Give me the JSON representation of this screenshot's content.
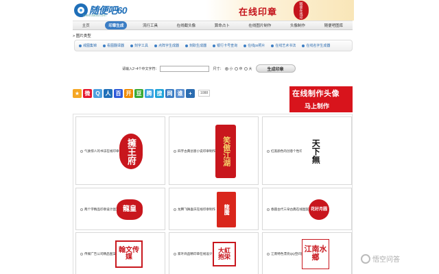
{
  "header": {
    "logo_text": "随便吧60",
    "logo_sub": "www.sbba.com",
    "banner_title": "在线印章",
    "banner_seal_text": "随便在线印"
  },
  "nav": {
    "items": [
      {
        "label": "主页",
        "active": false
      },
      {
        "label": "印章生成",
        "active": true
      },
      {
        "label": "流行工具",
        "active": false
      },
      {
        "label": "在线截头像",
        "active": false
      },
      {
        "label": "算命占卜",
        "active": false
      },
      {
        "label": "在线图片制作",
        "active": false
      },
      {
        "label": "头像制作",
        "active": false
      },
      {
        "label": "随便吧图库",
        "active": false
      }
    ]
  },
  "category": {
    "title": "> 图片类型",
    "items": [
      "戒图集锦",
      "看图翻译器",
      "刻字工具",
      "点阵字生成器",
      "刻职生成器",
      "银行卡号查询",
      "在线ps照片",
      "在线艺术书法",
      "在线名字生成器"
    ]
  },
  "form": {
    "label": "请输入2~4个中文字符：",
    "input_value": "",
    "size_label": "尺寸：",
    "sizes": [
      {
        "label": "小",
        "checked": true
      },
      {
        "label": "中",
        "checked": false
      },
      {
        "label": "大",
        "checked": false
      }
    ],
    "button_label": "生成印章"
  },
  "share": {
    "icons": [
      {
        "name": "star-icon",
        "glyph": "★",
        "color": "#f5a623"
      },
      {
        "name": "weibo-icon",
        "glyph": "微",
        "color": "#e6162d"
      },
      {
        "name": "qzone-icon",
        "glyph": "Q",
        "color": "#4ea1e0"
      },
      {
        "name": "renren-icon",
        "glyph": "人",
        "color": "#1f6fb8"
      },
      {
        "name": "baidu-icon",
        "glyph": "百",
        "color": "#2e59d9"
      },
      {
        "name": "kaixin-icon",
        "glyph": "开",
        "color": "#f08a00"
      },
      {
        "name": "douban-icon",
        "glyph": "豆",
        "color": "#3aaa35"
      },
      {
        "name": "tencent-icon",
        "glyph": "腾",
        "color": "#3aa3e3"
      },
      {
        "name": "sohu-icon",
        "glyph": "搜",
        "color": "#1ea3d9"
      },
      {
        "name": "netease-icon",
        "glyph": "网",
        "color": "#3b7dc4"
      },
      {
        "name": "more-icon",
        "glyph": "谁",
        "color": "#5a8fd0"
      },
      {
        "name": "plus-icon",
        "glyph": "+",
        "color": "#2b6cb0"
      }
    ],
    "count": "1088"
  },
  "ad": {
    "line1": "在线制作头像",
    "line2": "马上制作"
  },
  "cards": [
    {
      "caption": "气质惊人的书法在线印章设计",
      "seal_text": "擁王府",
      "style": "oval-red"
    },
    {
      "caption": "四字古典创意小说印章制作",
      "seal_text": "笑傲江湖",
      "style": "rect-red"
    },
    {
      "caption": "红黑颜色的创意个性印章设计",
      "seal_text": "天下無",
      "style": "black-brush"
    },
    {
      "caption": "两个字精品印章设计图案",
      "seal_text": "龍皇",
      "style": "round-red"
    },
    {
      "caption": "龙腾飞舞喜庆在线印章制作",
      "seal_text": "龍騰",
      "style": "dragon-red"
    },
    {
      "caption": "春圆古代三朵古典在线图案",
      "seal_text": "花好月圆",
      "style": "flower-red"
    },
    {
      "caption": "传媒广告公司精品图案制作",
      "seal_text": "翰文传媒",
      "style": "square-red"
    },
    {
      "caption": "家叶商品精印章在线设计",
      "seal_text": "大紅抱栄",
      "style": "box-red"
    },
    {
      "caption": "江南特色漂亮QQ空间图案",
      "seal_text": "江南水鄉",
      "style": "outline-red"
    }
  ],
  "watermark": "悟空问答"
}
